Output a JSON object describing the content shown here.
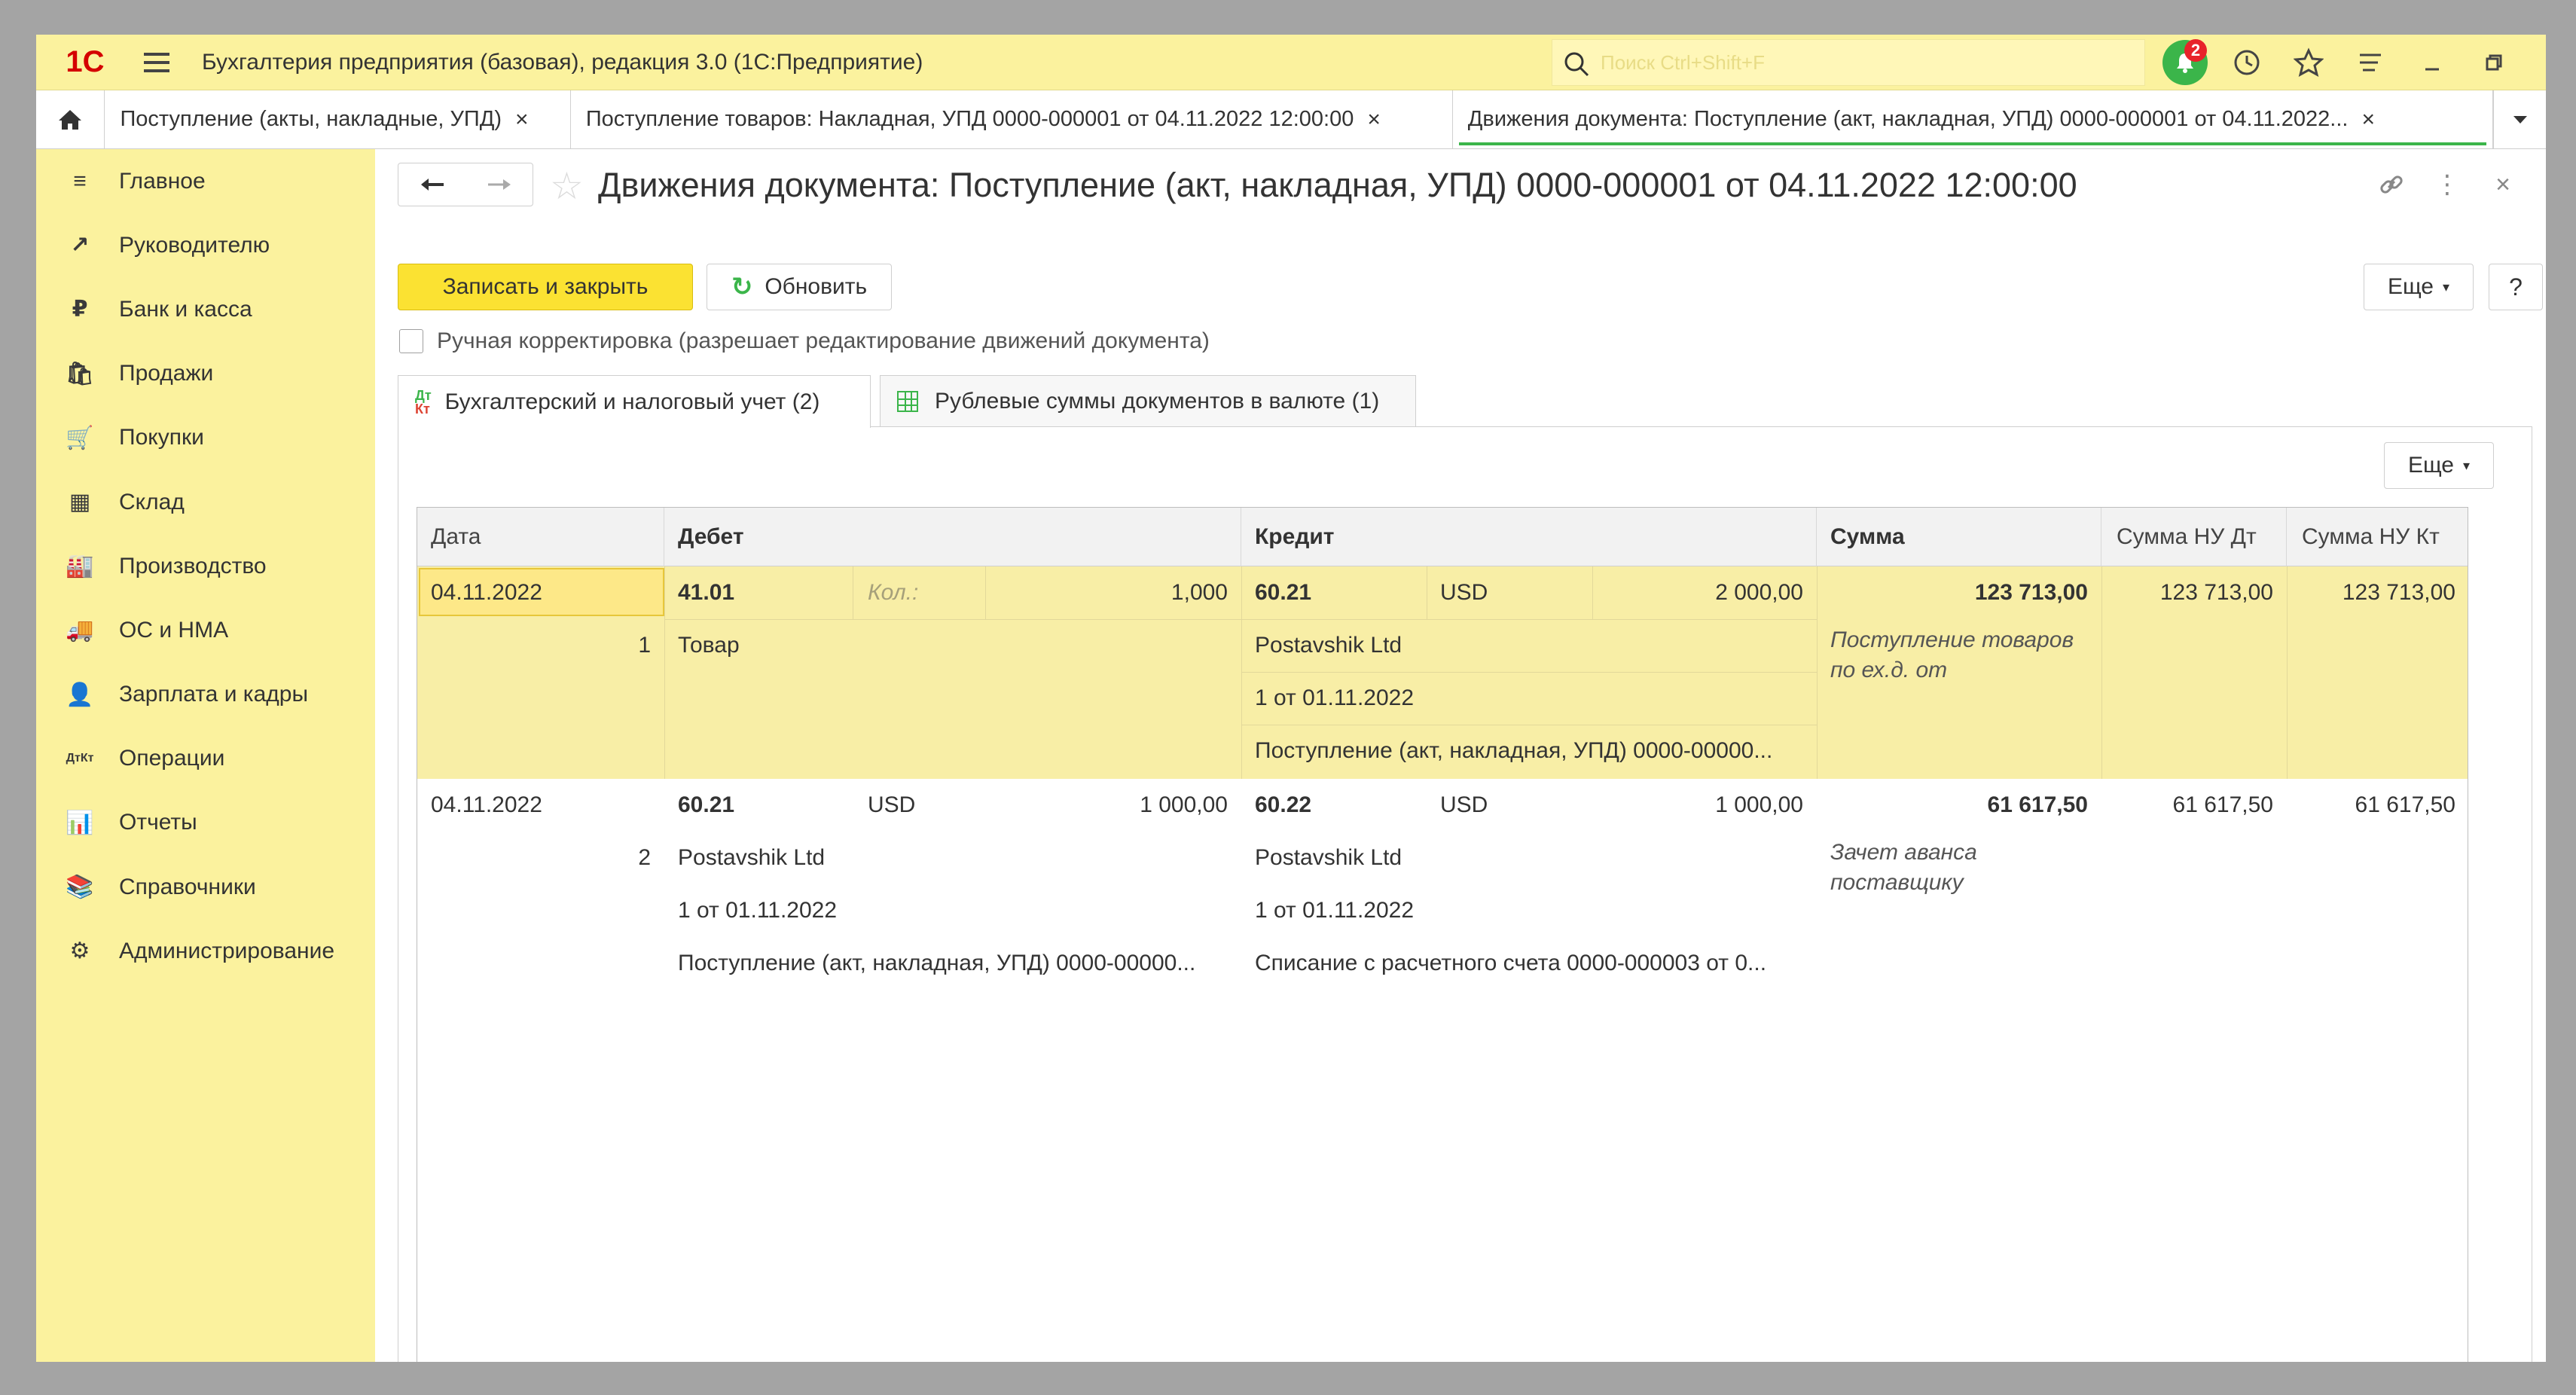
{
  "app": {
    "logo": "1С",
    "title": "Бухгалтерия предприятия (базовая), редакция 3.0  (1С:Предприятие)",
    "search_placeholder": "Поиск Ctrl+Shift+F",
    "notification_count": "2"
  },
  "tabs": [
    {
      "label": "Поступление (акты, накладные, УПД)",
      "close": "×"
    },
    {
      "label": "Поступление товаров: Накладная, УПД 0000-000001 от 04.11.2022 12:00:00",
      "close": "×"
    },
    {
      "label": "Движения документа: Поступление (акт, накладная, УПД) 0000-000001 от 04.11.2022...",
      "close": "×"
    }
  ],
  "sidebar": {
    "items": [
      {
        "label": "Главное",
        "icon": "≡"
      },
      {
        "label": "Руководителю",
        "icon": "↗"
      },
      {
        "label": "Банк и касса",
        "icon": "₽"
      },
      {
        "label": "Продажи",
        "icon": "🛍"
      },
      {
        "label": "Покупки",
        "icon": "🛒"
      },
      {
        "label": "Склад",
        "icon": "▦"
      },
      {
        "label": "Производство",
        "icon": "🏭"
      },
      {
        "label": "ОС и НМА",
        "icon": "🚚"
      },
      {
        "label": "Зарплата и кадры",
        "icon": "👤"
      },
      {
        "label": "Операции",
        "icon": "ДтКт"
      },
      {
        "label": "Отчеты",
        "icon": "📊"
      },
      {
        "label": "Справочники",
        "icon": "📚"
      },
      {
        "label": "Администрирование",
        "icon": "⚙"
      }
    ]
  },
  "form": {
    "title": "Движения документа: Поступление (акт, накладная, УПД) 0000-000001 от 04.11.2022 12:00:00",
    "save_close": "Записать и закрыть",
    "refresh": "Обновить",
    "more": "Еще",
    "help": "?",
    "manual_edit": "Ручная корректировка (разрешает редактирование движений документа)",
    "tab1": "Бухгалтерский и налоговый учет (2)",
    "tab2": "Рублевые суммы документов в валюте (1)",
    "dtkt_top": "Дт",
    "dtkt_bot": "Кт",
    "panel_more": "Еще"
  },
  "table": {
    "headers": {
      "date": "Дата",
      "debit": "Дебет",
      "credit": "Кредит",
      "sum": "Сумма",
      "sum_nu_dt": "Сумма НУ Дт",
      "sum_nu_kt": "Сумма НУ Кт"
    },
    "rows": [
      {
        "date": "04.11.2022",
        "num": "1",
        "dt_account": "41.01",
        "dt_qty_label": "Кол.:",
        "dt_amount": "1,000",
        "dt_sub1": "Товар",
        "kt_account": "60.21",
        "kt_currency": "USD",
        "kt_amount": "2 000,00",
        "kt_sub1": "Postavshik Ltd",
        "kt_sub2": "1 от 01.11.2022",
        "kt_sub3": "Поступление (акт, накладная, УПД) 0000-00000...",
        "sum": "123 713,00",
        "content": "Поступление товаров по ех.д.  от",
        "sum_nu_dt": "123 713,00",
        "sum_nu_kt": "123 713,00"
      },
      {
        "date": "04.11.2022",
        "num": "2",
        "dt_account": "60.21",
        "dt_currency": "USD",
        "dt_amount": "1 000,00",
        "dt_sub1": "Postavshik Ltd",
        "dt_sub2": "1 от 01.11.2022",
        "dt_sub3": "Поступление (акт, накладная, УПД) 0000-00000...",
        "kt_account": "60.22",
        "kt_currency": "USD",
        "kt_amount": "1 000,00",
        "kt_sub1": "Postavshik Ltd",
        "kt_sub2": "1 от 01.11.2022",
        "kt_sub3": "Списание с расчетного счета 0000-000003 от 0...",
        "sum": "61 617,50",
        "content": "Зачет аванса поставщику",
        "sum_nu_dt": "61 617,50",
        "sum_nu_kt": "61 617,50"
      }
    ]
  },
  "colors": {
    "accent_yellow": "#fbf29e",
    "button_yellow": "#fbe232",
    "green": "#3bb54a",
    "selected_row": "#f8eea6"
  }
}
